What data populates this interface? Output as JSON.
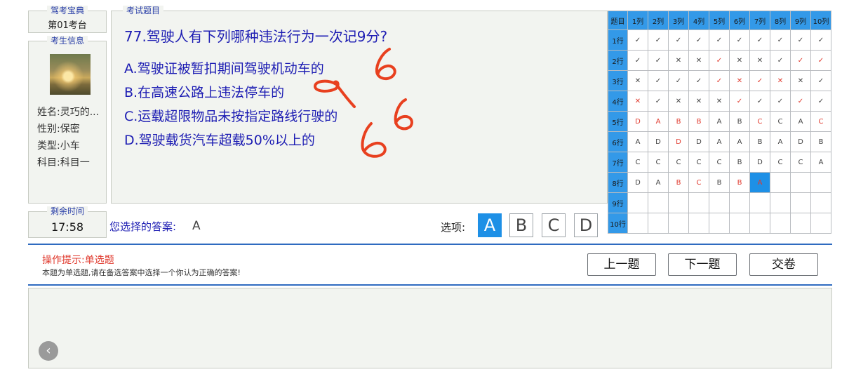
{
  "exam_station": {
    "title": "驾考宝典",
    "station": "第01考台"
  },
  "candidate": {
    "title": "考生信息",
    "name": "姓名:灵巧的...",
    "gender": "性别:保密",
    "type": "类型:小车",
    "subject": "科目:科目一"
  },
  "question": {
    "panel_title": "考试题目",
    "text": "77.驾驶人有下列哪种违法行为一次记9分?",
    "options": [
      "A.驾驶证被暂扣期间驾驶机动车的",
      "B.在高速公路上违法停车的",
      "C.运载超限物品未按指定路线行驶的",
      "D.驾驶载货汽车超载50%以上的"
    ],
    "annotation_color": "#e8401f"
  },
  "timer": {
    "title": "剩余时间",
    "value": "17:58"
  },
  "answer": {
    "label": "您选择的答案:",
    "value": "A"
  },
  "choices": {
    "label": "选项:",
    "buttons": [
      "A",
      "B",
      "C",
      "D"
    ],
    "selected": "A"
  },
  "grid": {
    "corner": "题目",
    "columns": [
      "1列",
      "2列",
      "3列",
      "4列",
      "5列",
      "6列",
      "7列",
      "8列",
      "9列",
      "10列"
    ],
    "rows": [
      {
        "label": "1行",
        "cells": [
          {
            "t": "✓"
          },
          {
            "t": "✓"
          },
          {
            "t": "✓"
          },
          {
            "t": "✓"
          },
          {
            "t": "✓"
          },
          {
            "t": "✓"
          },
          {
            "t": "✓"
          },
          {
            "t": "✓"
          },
          {
            "t": "✓"
          },
          {
            "t": "✓"
          }
        ]
      },
      {
        "label": "2行",
        "cells": [
          {
            "t": "✓"
          },
          {
            "t": "✓"
          },
          {
            "t": "✕"
          },
          {
            "t": "✕"
          },
          {
            "t": "✓",
            "r": 1
          },
          {
            "t": "✕"
          },
          {
            "t": "✕"
          },
          {
            "t": "✓"
          },
          {
            "t": "✓",
            "r": 1
          },
          {
            "t": "✓",
            "r": 1
          }
        ]
      },
      {
        "label": "3行",
        "cells": [
          {
            "t": "✕"
          },
          {
            "t": "✓"
          },
          {
            "t": "✓"
          },
          {
            "t": "✓"
          },
          {
            "t": "✓",
            "r": 1
          },
          {
            "t": "✕",
            "r": 1
          },
          {
            "t": "✓",
            "r": 1
          },
          {
            "t": "✕",
            "r": 1
          },
          {
            "t": "✕"
          },
          {
            "t": "✓"
          }
        ]
      },
      {
        "label": "4行",
        "cells": [
          {
            "t": "✕",
            "r": 1
          },
          {
            "t": "✓"
          },
          {
            "t": "✕"
          },
          {
            "t": "✕"
          },
          {
            "t": "✕"
          },
          {
            "t": "✓",
            "r": 1
          },
          {
            "t": "✓"
          },
          {
            "t": "✓"
          },
          {
            "t": "✓",
            "r": 1
          },
          {
            "t": "✓"
          }
        ]
      },
      {
        "label": "5行",
        "cells": [
          {
            "t": "D",
            "r": 1
          },
          {
            "t": "A",
            "r": 1
          },
          {
            "t": "B",
            "r": 1
          },
          {
            "t": "B",
            "r": 1
          },
          {
            "t": "A"
          },
          {
            "t": "B"
          },
          {
            "t": "C",
            "r": 1
          },
          {
            "t": "C"
          },
          {
            "t": "A"
          },
          {
            "t": "C",
            "r": 1
          }
        ]
      },
      {
        "label": "6行",
        "cells": [
          {
            "t": "A"
          },
          {
            "t": "D"
          },
          {
            "t": "D",
            "r": 1
          },
          {
            "t": "D"
          },
          {
            "t": "A"
          },
          {
            "t": "A"
          },
          {
            "t": "B"
          },
          {
            "t": "A"
          },
          {
            "t": "D"
          },
          {
            "t": "B"
          }
        ]
      },
      {
        "label": "7行",
        "cells": [
          {
            "t": "C"
          },
          {
            "t": "C"
          },
          {
            "t": "C"
          },
          {
            "t": "C"
          },
          {
            "t": "C"
          },
          {
            "t": "B"
          },
          {
            "t": "D"
          },
          {
            "t": "C"
          },
          {
            "t": "C"
          },
          {
            "t": "A"
          }
        ]
      },
      {
        "label": "8行",
        "cells": [
          {
            "t": "D"
          },
          {
            "t": "A"
          },
          {
            "t": "B",
            "r": 1
          },
          {
            "t": "C",
            "r": 1
          },
          {
            "t": "B"
          },
          {
            "t": "B",
            "r": 1
          },
          {
            "t": "A",
            "r": 1,
            "cur": 1
          },
          {
            "t": ""
          },
          {
            "t": ""
          },
          {
            "t": ""
          }
        ]
      },
      {
        "label": "9行",
        "cells": [
          {
            "t": ""
          },
          {
            "t": ""
          },
          {
            "t": ""
          },
          {
            "t": ""
          },
          {
            "t": ""
          },
          {
            "t": ""
          },
          {
            "t": ""
          },
          {
            "t": ""
          },
          {
            "t": ""
          },
          {
            "t": ""
          }
        ]
      },
      {
        "label": "10行",
        "cells": [
          {
            "t": ""
          },
          {
            "t": ""
          },
          {
            "t": ""
          },
          {
            "t": ""
          },
          {
            "t": ""
          },
          {
            "t": ""
          },
          {
            "t": ""
          },
          {
            "t": ""
          },
          {
            "t": ""
          },
          {
            "t": ""
          }
        ]
      }
    ]
  },
  "hint": {
    "title": "操作提示:单选题",
    "body": "本题为单选题,请在备选答案中选择一个你认为正确的答案!"
  },
  "nav": {
    "prev": "上一题",
    "next": "下一题",
    "submit": "交卷",
    "back_icon": "‹"
  }
}
